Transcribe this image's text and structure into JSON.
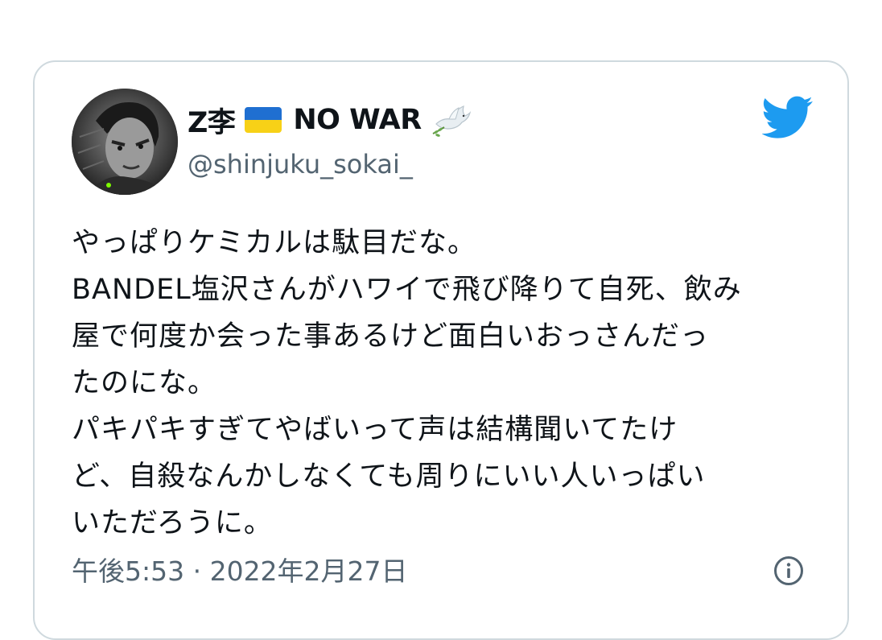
{
  "author": {
    "name": "Z李",
    "name_suffix": "NO WAR",
    "handle": "@shinjuku_sokai_",
    "flag": "ukraine-flag",
    "emoji": "dove-icon"
  },
  "tweet": {
    "lines": [
      "やっぱりケミカルは駄目だな。",
      "BANDEL塩沢さんがハワイで飛び降りて自死、飲み",
      "屋で何度か会った事あるけど面白いおっさんだっ",
      "たのにな。",
      "パキパキすぎてやばいって声は結構聞いてたけ",
      "ど、自殺なんかしなくても周りにいい人いっぱい",
      "いただろうに。"
    ],
    "timestamp": "午後5:53 · 2022年2月27日"
  },
  "icons": {
    "brand": "twitter-bird-icon",
    "info": "info-icon"
  },
  "colors": {
    "twitter_blue": "#1d9bf0",
    "text_primary": "#0f1419",
    "text_secondary": "#536471",
    "border": "#cfd9de",
    "flag_blue": "#1f6fd1",
    "flag_yellow": "#f7d117"
  }
}
